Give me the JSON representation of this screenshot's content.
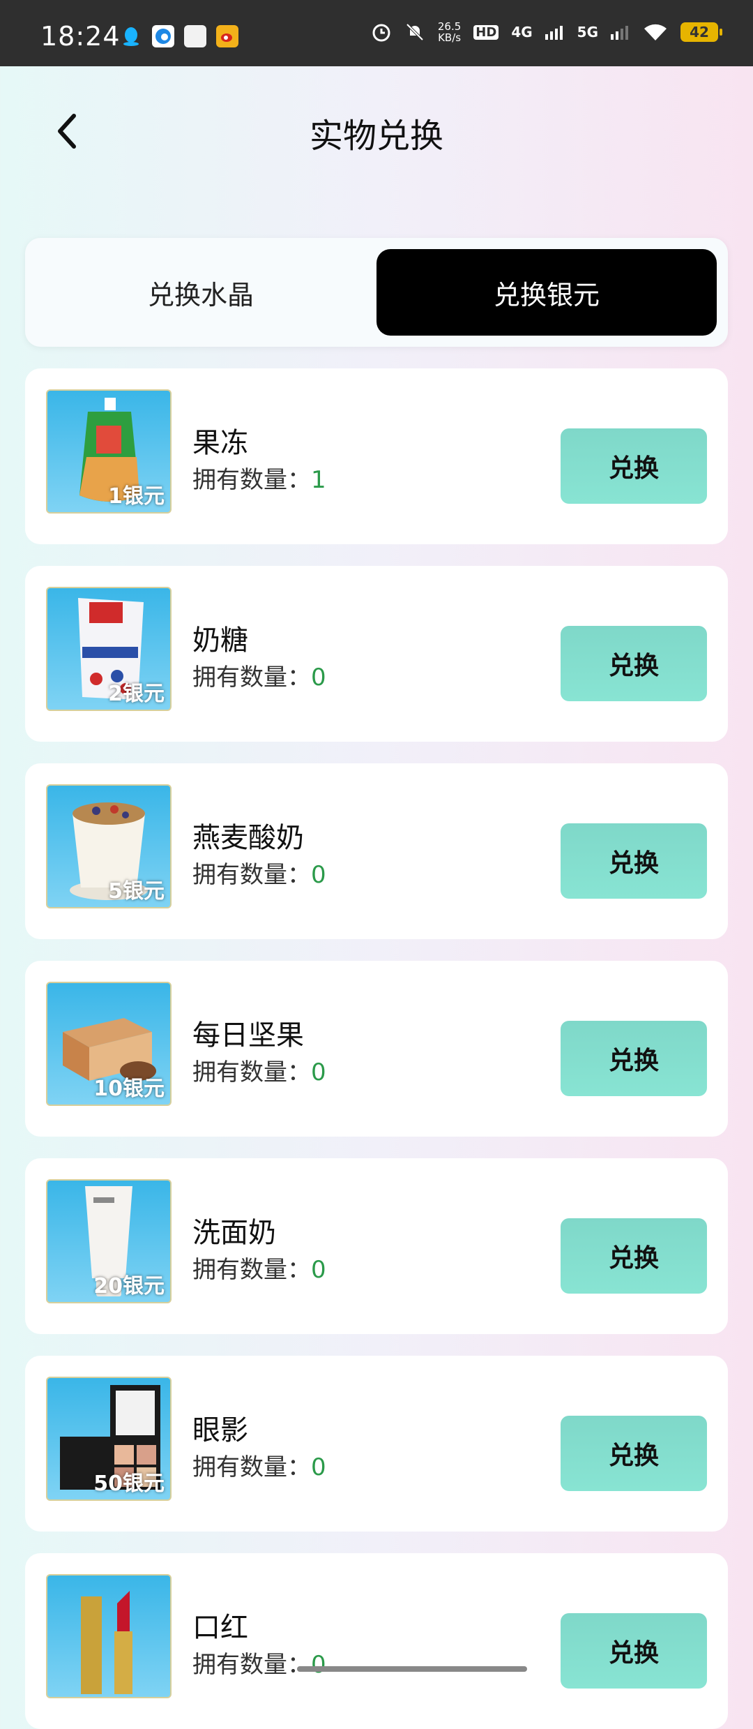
{
  "status_bar": {
    "time": "18:24",
    "net_speed_value": "26.5",
    "net_speed_unit": "KB/s",
    "hd": "HD",
    "signal_1": "4G",
    "signal_2": "5G",
    "battery": "42",
    "icons": [
      "qq-icon",
      "edge-browser-icon",
      "app-icon",
      "weibo-icon",
      "alarm-icon",
      "mute-icon",
      "wifi-icon"
    ]
  },
  "header": {
    "title": "实物兑换"
  },
  "tabs": [
    {
      "label": "兑换水晶",
      "active": false
    },
    {
      "label": "兑换银元",
      "active": true
    }
  ],
  "owned_label": "拥有数量：",
  "redeem_label": "兑换",
  "items": [
    {
      "name": "果冻",
      "owned": "1",
      "price": "1银元",
      "icon": "jelly-icon"
    },
    {
      "name": "奶糖",
      "owned": "0",
      "price": "2银元",
      "icon": "candy-bag-icon"
    },
    {
      "name": "燕麦酸奶",
      "owned": "0",
      "price": "5银元",
      "icon": "yogurt-cup-icon"
    },
    {
      "name": "每日坚果",
      "owned": "0",
      "price": "10银元",
      "icon": "nut-box-icon"
    },
    {
      "name": "洗面奶",
      "owned": "0",
      "price": "20银元",
      "icon": "cleanser-tube-icon"
    },
    {
      "name": "眼影",
      "owned": "0",
      "price": "50银元",
      "icon": "eyeshadow-palette-icon"
    },
    {
      "name": "口红",
      "owned": "0",
      "price": "",
      "icon": "lipstick-icon"
    }
  ],
  "colors": {
    "active_tab": "#000000",
    "button": "#7fd8c9",
    "owned_value": "#2b9a4a"
  }
}
